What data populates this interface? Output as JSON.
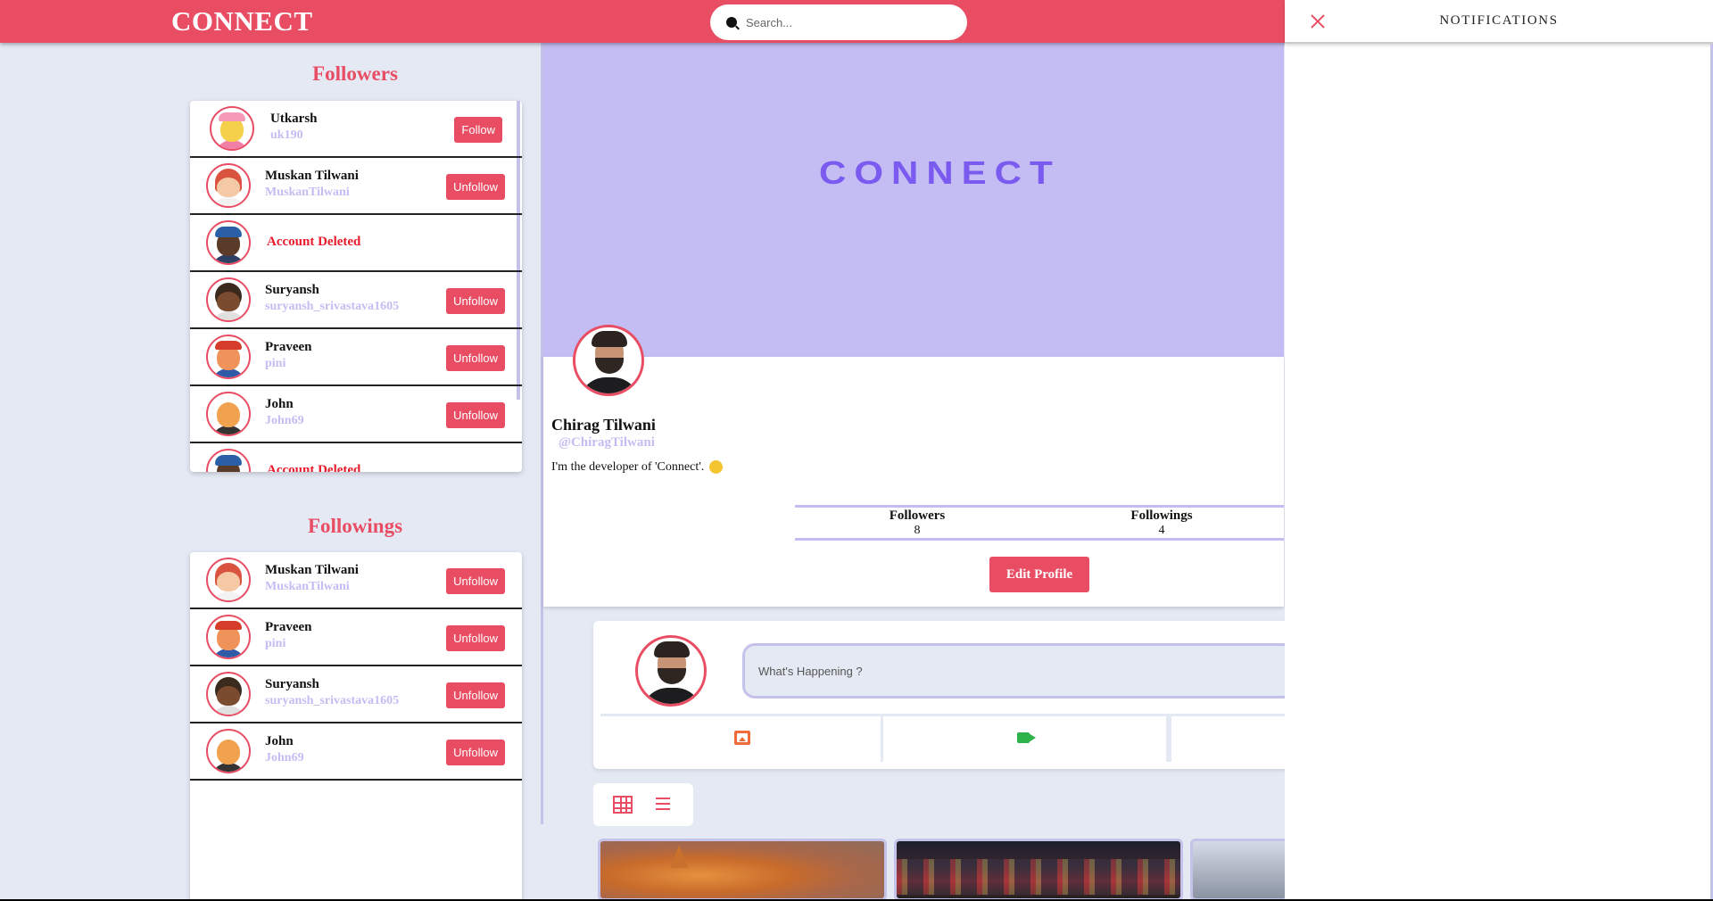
{
  "header": {
    "logo": "CONNECT",
    "search_placeholder": "Search..."
  },
  "followers": {
    "title": "Followers",
    "items": [
      {
        "name": "Utkarsh",
        "username": "uk190",
        "button": "Follow",
        "deleted": false
      },
      {
        "name": "Muskan Tilwani",
        "username": "MuskanTilwani",
        "button": "Unfollow",
        "deleted": false
      },
      {
        "name": "Account Deleted",
        "username": "",
        "button": "",
        "deleted": true
      },
      {
        "name": "Suryansh",
        "username": "suryansh_srivastava1605",
        "button": "Unfollow",
        "deleted": false
      },
      {
        "name": "Praveen",
        "username": "pini",
        "button": "Unfollow",
        "deleted": false
      },
      {
        "name": "John",
        "username": "John69",
        "button": "Unfollow",
        "deleted": false
      },
      {
        "name": "Account Deleted",
        "username": "",
        "button": "",
        "deleted": true
      }
    ]
  },
  "followings": {
    "title": "Followings",
    "items": [
      {
        "name": "Muskan Tilwani",
        "username": "MuskanTilwani",
        "button": "Unfollow"
      },
      {
        "name": "Praveen",
        "username": "pini",
        "button": "Unfollow"
      },
      {
        "name": "Suryansh",
        "username": "suryansh_srivastava1605",
        "button": "Unfollow"
      },
      {
        "name": "John",
        "username": "John69",
        "button": "Unfollow"
      }
    ]
  },
  "profile": {
    "banner_text": "CONNECT",
    "name": "Chirag Tilwani",
    "handle": "@ChiragTilwani",
    "bio": "I'm the developer of 'Connect'.",
    "followers_label": "Followers",
    "followers_count": "8",
    "followings_label": "Followings",
    "followings_count": "4",
    "edit_button": "Edit Profile"
  },
  "composer": {
    "placeholder": "What's Happening ?",
    "actions": [
      "image-icon",
      "video-icon"
    ]
  },
  "view_toggle": [
    "grid-icon",
    "list-icon"
  ],
  "notifications": {
    "title": "NOTIFICATIONS"
  },
  "colors": {
    "brand": "#e84d64",
    "lavender": "#c3bdf3",
    "banner_text": "#7b5bef",
    "background": "#e5e9f4"
  }
}
